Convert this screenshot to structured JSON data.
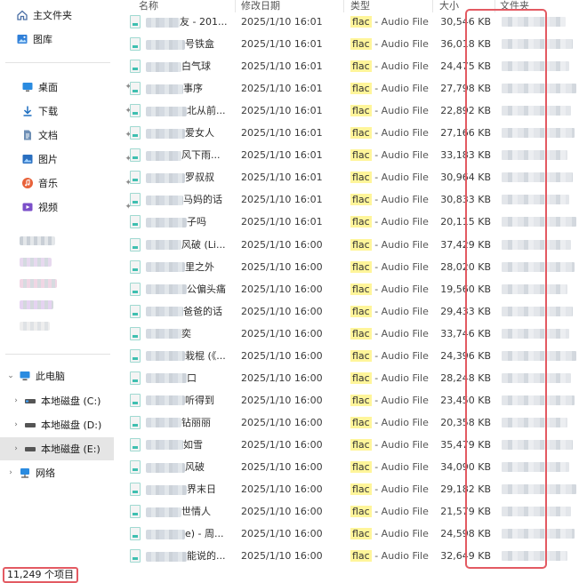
{
  "sidebar": {
    "quick": [
      {
        "label": "主文件夹",
        "icon": "home-icon"
      },
      {
        "label": "图库",
        "icon": "gallery-icon"
      }
    ],
    "pinned": [
      {
        "label": "桌面",
        "icon": "desktop-icon"
      },
      {
        "label": "下载",
        "icon": "download-icon"
      },
      {
        "label": "文档",
        "icon": "document-icon"
      },
      {
        "label": "图片",
        "icon": "picture-icon"
      },
      {
        "label": "音乐",
        "icon": "music-icon"
      },
      {
        "label": "视频",
        "icon": "video-icon"
      }
    ],
    "this_pc": {
      "label": "此电脑",
      "icon": "computer-icon"
    },
    "drives": [
      {
        "label": "本地磁盘 (C:)",
        "icon": "drive-icon"
      },
      {
        "label": "本地磁盘 (D:)",
        "icon": "drive-icon"
      },
      {
        "label": "本地磁盘 (E:)",
        "icon": "drive-icon",
        "selected": true
      }
    ],
    "network": {
      "label": "网络",
      "icon": "network-icon"
    }
  },
  "columns": {
    "name": "名称",
    "date": "修改日期",
    "type": "类型",
    "size": "大小",
    "folder": "文件夹"
  },
  "files": [
    {
      "name_visible": "友 - 201...",
      "date": "2025/1/10 16:01",
      "type_tag": "flac",
      "type_rest": " - Audio File",
      "size": "30,546 KB"
    },
    {
      "name_visible": "号铁盒",
      "date": "2025/1/10 16:01",
      "type_tag": "flac",
      "type_rest": " - Audio File",
      "size": "36,018 KB"
    },
    {
      "name_visible": "白气球",
      "date": "2025/1/10 16:01",
      "type_tag": "flac",
      "type_rest": " - Audio File",
      "size": "24,475 KB"
    },
    {
      "name_visible": "事序",
      "date": "2025/1/10 16:01",
      "type_tag": "flac",
      "type_rest": " - Audio File",
      "size": "27,798 KB"
    },
    {
      "name_visible": "北从前...",
      "date": "2025/1/10 16:01",
      "type_tag": "flac",
      "type_rest": " - Audio File",
      "size": "22,892 KB"
    },
    {
      "name_visible": "爱女人",
      "date": "2025/1/10 16:01",
      "type_tag": "flac",
      "type_rest": " - Audio File",
      "size": "27,166 KB"
    },
    {
      "name_visible": "风下雨...",
      "date": "2025/1/10 16:01",
      "type_tag": "flac",
      "type_rest": " - Audio File",
      "size": "33,183 KB"
    },
    {
      "name_visible": "罗叔叔",
      "date": "2025/1/10 16:01",
      "type_tag": "flac",
      "type_rest": " - Audio File",
      "size": "30,964 KB"
    },
    {
      "name_visible": "马妈的话",
      "date": "2025/1/10 16:01",
      "type_tag": "flac",
      "type_rest": " - Audio File",
      "size": "30,833 KB"
    },
    {
      "name_visible": "子吗",
      "date": "2025/1/10 16:01",
      "type_tag": "flac",
      "type_rest": " - Audio File",
      "size": "20,115 KB"
    },
    {
      "name_visible": "风破 (Li...",
      "date": "2025/1/10 16:00",
      "type_tag": "flac",
      "type_rest": " - Audio File",
      "size": "37,429 KB"
    },
    {
      "name_visible": "里之外",
      "date": "2025/1/10 16:00",
      "type_tag": "flac",
      "type_rest": " - Audio File",
      "size": "28,020 KB"
    },
    {
      "name_visible": "公偏头痛",
      "date": "2025/1/10 16:00",
      "type_tag": "flac",
      "type_rest": " - Audio File",
      "size": "19,560 KB"
    },
    {
      "name_visible": "爸爸的话",
      "date": "2025/1/10 16:00",
      "type_tag": "flac",
      "type_rest": " - Audio File",
      "size": "29,433 KB"
    },
    {
      "name_visible": "奕",
      "date": "2025/1/10 16:00",
      "type_tag": "flac",
      "type_rest": " - Audio File",
      "size": "33,746 KB"
    },
    {
      "name_visible": "栽棍 (《...",
      "date": "2025/1/10 16:00",
      "type_tag": "flac",
      "type_rest": " - Audio File",
      "size": "24,396 KB"
    },
    {
      "name_visible": "口",
      "date": "2025/1/10 16:00",
      "type_tag": "flac",
      "type_rest": " - Audio File",
      "size": "28,248 KB"
    },
    {
      "name_visible": "听得到",
      "date": "2025/1/10 16:00",
      "type_tag": "flac",
      "type_rest": " - Audio File",
      "size": "23,450 KB"
    },
    {
      "name_visible": "钻丽丽",
      "date": "2025/1/10 16:00",
      "type_tag": "flac",
      "type_rest": " - Audio File",
      "size": "20,358 KB"
    },
    {
      "name_visible": "如雪",
      "date": "2025/1/10 16:00",
      "type_tag": "flac",
      "type_rest": " - Audio File",
      "size": "35,479 KB"
    },
    {
      "name_visible": "风破",
      "date": "2025/1/10 16:00",
      "type_tag": "flac",
      "type_rest": " - Audio File",
      "size": "34,090 KB"
    },
    {
      "name_visible": "界末日",
      "date": "2025/1/10 16:00",
      "type_tag": "flac",
      "type_rest": " - Audio File",
      "size": "29,182 KB"
    },
    {
      "name_visible": "世情人",
      "date": "2025/1/10 16:00",
      "type_tag": "flac",
      "type_rest": " - Audio File",
      "size": "21,579 KB"
    },
    {
      "name_visible": "e) - 周...",
      "date": "2025/1/10 16:00",
      "type_tag": "flac",
      "type_rest": " - Audio File",
      "size": "24,598 KB"
    },
    {
      "name_visible": "能说的...",
      "date": "2025/1/10 16:00",
      "type_tag": "flac",
      "type_rest": " - Audio File",
      "size": "32,649 KB"
    }
  ],
  "status": {
    "count": "11,249 个项目"
  },
  "colors": {
    "highlight": "#e35a62",
    "tag": "#fff59a",
    "selected": "#e5e5e5"
  }
}
